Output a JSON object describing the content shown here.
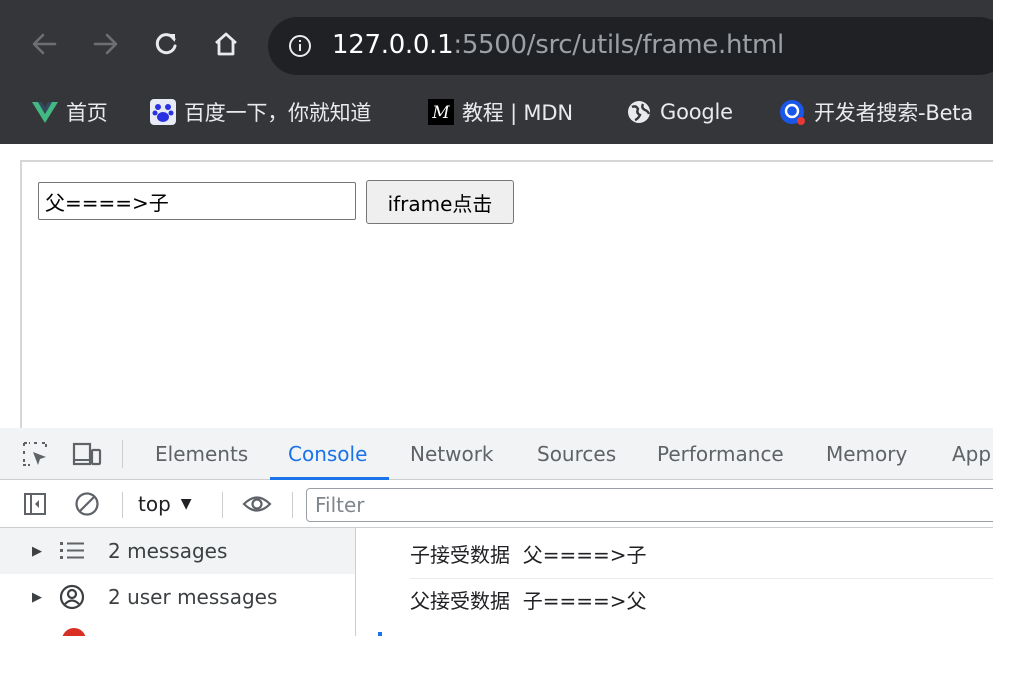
{
  "browser": {
    "url_host": "127.0.0.1",
    "url_rest": ":5500/src/utils/frame.html",
    "nav_icons": [
      "back-arrow-icon",
      "forward-arrow-icon",
      "reload-icon",
      "home-icon",
      "info-icon"
    ]
  },
  "bookmarks": [
    {
      "label": "首页",
      "icon": "vue-logo-icon"
    },
    {
      "label": "百度一下，你就知道",
      "icon": "baidu-paw-icon"
    },
    {
      "label": "教程 | MDN",
      "icon": "mdn-logo-icon"
    },
    {
      "label": "Google",
      "icon": "globe-icon"
    },
    {
      "label": "开发者搜索-Beta",
      "icon": "dev-search-icon"
    }
  ],
  "page": {
    "input_value": "父====>子",
    "button_label": "iframe点击"
  },
  "devtools": {
    "tabs": [
      "Elements",
      "Console",
      "Network",
      "Sources",
      "Performance",
      "Memory",
      "App"
    ],
    "active_tab": "Console",
    "context": "top",
    "filter_placeholder": "Filter"
  },
  "sidebar": {
    "items": [
      {
        "label": "2 messages",
        "icon": "list-icon"
      },
      {
        "label": "2 user messages",
        "icon": "user-circle-icon"
      }
    ]
  },
  "console": {
    "lines": [
      "子接受数据  父====>子",
      "父接受数据  子====>父"
    ]
  },
  "colors": {
    "chrome_bg": "#35363a",
    "omnibox_bg": "#202124",
    "accent": "#1a73e8",
    "vue_green": "#42b883",
    "error_red": "#d93025"
  }
}
